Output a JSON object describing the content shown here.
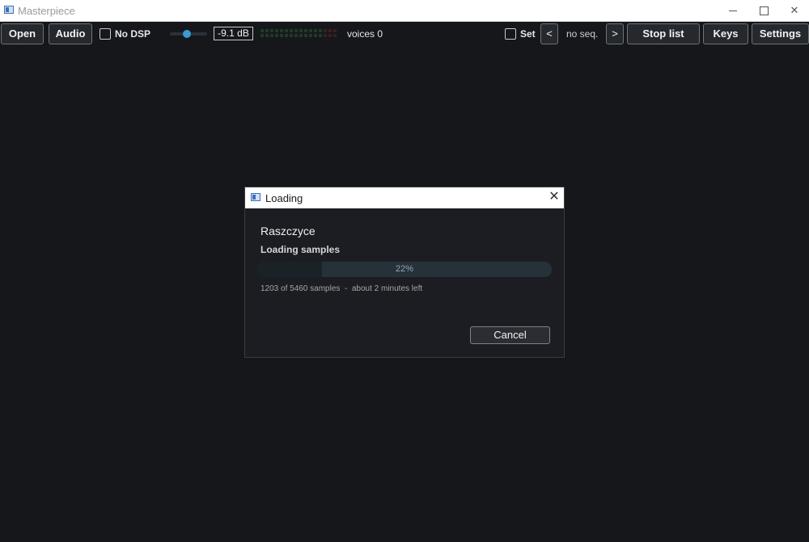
{
  "window": {
    "title": "Masterpiece"
  },
  "toolbar": {
    "open_label": "Open",
    "audio_label": "Audio",
    "no_dsp_label": "No DSP",
    "no_dsp_checked": false,
    "volume_level": 0.45,
    "volume_db": "-9.1 dB",
    "voices_label": "voices 0",
    "set_label": "Set",
    "set_checked": false,
    "prev_label": "<",
    "seq_label": "no seq.",
    "next_label": ">",
    "stop_list_label": "Stop list",
    "keys_label": "Keys",
    "settings_label": "Settings"
  },
  "dialog": {
    "title": "Loading",
    "close_glyph": "✕",
    "heading": "Raszczyce",
    "subheading": "Loading samples",
    "progress": 0.22,
    "progress_label": "22%",
    "detail": "1203 of 5460 samples  -  about 2 minutes left",
    "cancel_label": "Cancel"
  },
  "colors": {
    "background": "#16171b",
    "accent": "#3a9bd1",
    "meter_green": "#1f3a28",
    "meter_red": "#3a1f22"
  }
}
